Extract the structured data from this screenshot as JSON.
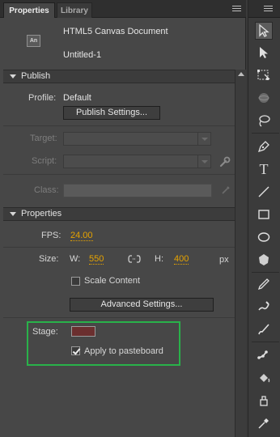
{
  "tabs": {
    "properties": "Properties",
    "library": "Library"
  },
  "document": {
    "type": "HTML5 Canvas Document",
    "name": "Untitled-1",
    "icon_text": "An"
  },
  "publish": {
    "header": "Publish",
    "profile_label": "Profile:",
    "profile_value": "Default",
    "settings_button": "Publish Settings...",
    "target_label": "Target:",
    "script_label": "Script:",
    "class_label": "Class:"
  },
  "properties": {
    "header": "Properties",
    "fps_label": "FPS:",
    "fps_value": "24.00",
    "size_label": "Size:",
    "w_label": "W:",
    "w_value": "550",
    "h_label": "H:",
    "h_value": "400",
    "unit": "px",
    "scale_content": "Scale Content",
    "advanced_button": "Advanced Settings...",
    "stage_label": "Stage:",
    "stage_color": "#6b2f2f",
    "apply_pasteboard": "Apply to pasteboard",
    "apply_pasteboard_checked": true,
    "scale_content_checked": false
  },
  "colors": {
    "accent_hot": "#e6a300",
    "highlight_box": "#29b24a"
  },
  "tools": [
    "selection-tool-icon",
    "subselection-tool-icon",
    "free-transform-tool-icon",
    "3d-rotation-tool-icon",
    "lasso-tool-icon",
    "pen-tool-icon",
    "text-tool-icon",
    "line-tool-icon",
    "rectangle-tool-icon",
    "oval-tool-icon",
    "polystar-tool-icon",
    "pencil-tool-icon",
    "brush-tool-icon",
    "paint-brush-tool-icon",
    "bone-tool-icon",
    "paint-bucket-tool-icon",
    "ink-bottle-tool-icon",
    "eyedropper-tool-icon"
  ]
}
